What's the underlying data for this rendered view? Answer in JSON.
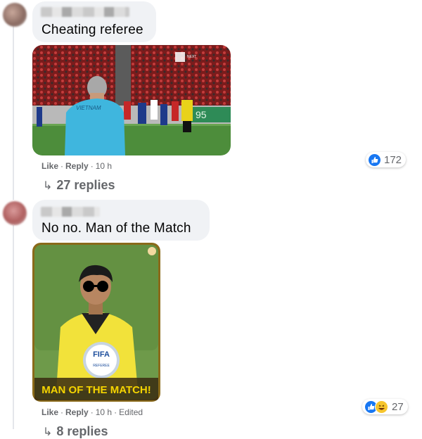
{
  "comments": [
    {
      "text": "Cheating referee",
      "actions": {
        "like": "Like",
        "reply": "Reply",
        "time": "10 h",
        "edited": ""
      },
      "replies_label": "27 replies",
      "reactions_count": "172",
      "media": {
        "jersey_text": "VIETNAM",
        "score_text": "95",
        "logo_text": "NEXT"
      }
    },
    {
      "text": "No no. Man of the Match",
      "actions": {
        "like": "Like",
        "reply": "Reply",
        "time": "10 h",
        "edited": "Edited"
      },
      "replies_label": "8 replies",
      "reactions_count": "27",
      "media": {
        "badge_top": "FIFA",
        "badge_bottom": "REFEREE",
        "caption": "MAN OF THE MATCH!"
      }
    }
  ],
  "colors": {
    "bubble": "#f0f2f5",
    "like_blue": "#1877f2",
    "meta_gray": "#65676b",
    "caption_yellow": "#f5d400"
  },
  "icons": {
    "reply_arrow": "reply-arrow-icon",
    "like": "like-reaction-icon",
    "haha": "haha-reaction-icon"
  }
}
